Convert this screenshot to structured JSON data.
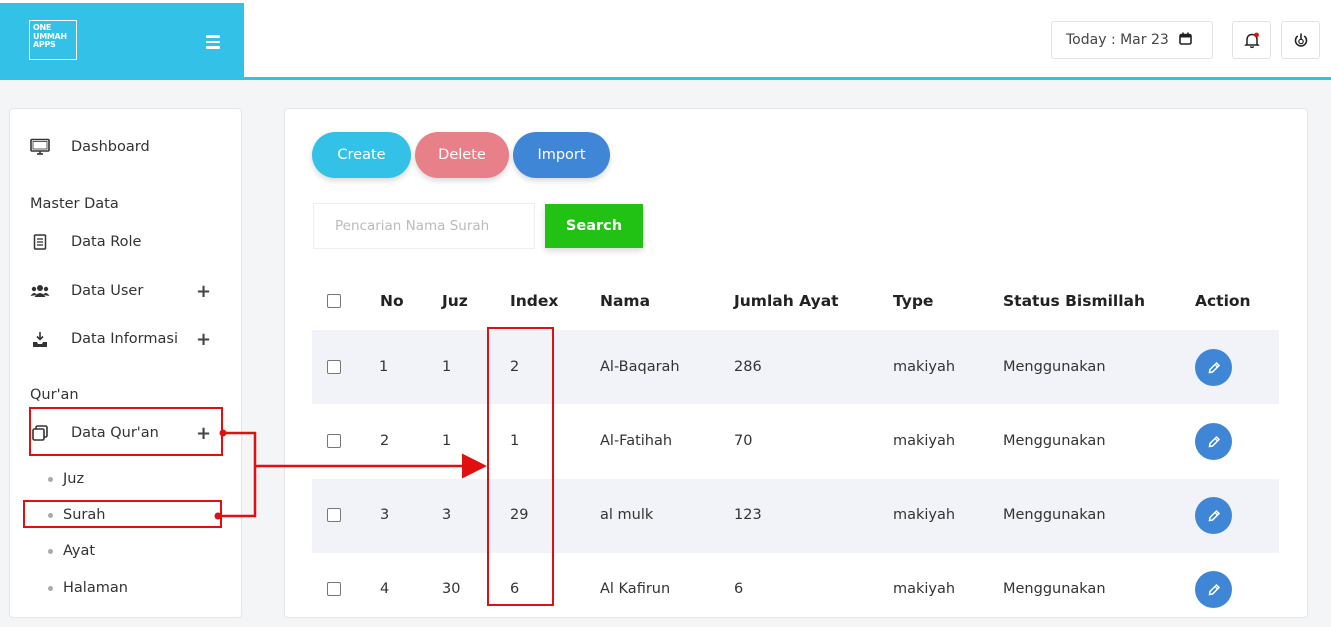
{
  "brand": {
    "logo_lines": [
      "ONE",
      "UMMAH",
      "APPS"
    ]
  },
  "header": {
    "today_label": "Today : Mar 23"
  },
  "sidebar": {
    "dashboard": "Dashboard",
    "section_master": "Master Data",
    "data_role": "Data Role",
    "data_user": "Data User",
    "data_informasi": "Data Informasi",
    "section_quran": "Qur'an",
    "data_quran": "Data Qur'an",
    "sub_items": [
      "Juz",
      "Surah",
      "Ayat",
      "Halaman"
    ]
  },
  "toolbar": {
    "create": "Create",
    "delete": "Delete",
    "import": "Import"
  },
  "search": {
    "placeholder": "Pencarian Nama Surah",
    "button": "Search"
  },
  "table": {
    "headers": [
      "No",
      "Juz",
      "Index",
      "Nama",
      "Jumlah Ayat",
      "Type",
      "Status Bismillah",
      "Action"
    ],
    "rows": [
      {
        "no": "1",
        "juz": "1",
        "index": "2",
        "nama": "Al-Baqarah",
        "ayat": "286",
        "type": "makiyah",
        "status": "Menggunakan"
      },
      {
        "no": "2",
        "juz": "1",
        "index": "1",
        "nama": "Al-Fatihah",
        "ayat": "70",
        "type": "makiyah",
        "status": "Menggunakan"
      },
      {
        "no": "3",
        "juz": "3",
        "index": "29",
        "nama": "al mulk",
        "ayat": "123",
        "type": "makiyah",
        "status": "Menggunakan"
      },
      {
        "no": "4",
        "juz": "30",
        "index": "6",
        "nama": "Al Kafirun",
        "ayat": "6",
        "type": "makiyah",
        "status": "Menggunakan"
      }
    ]
  },
  "colors": {
    "accent": "#33c1e8",
    "create": "#33c1e8",
    "delete": "#e8808a",
    "import": "#3f87d6",
    "search": "#22c214",
    "annotation": "#e01010"
  }
}
